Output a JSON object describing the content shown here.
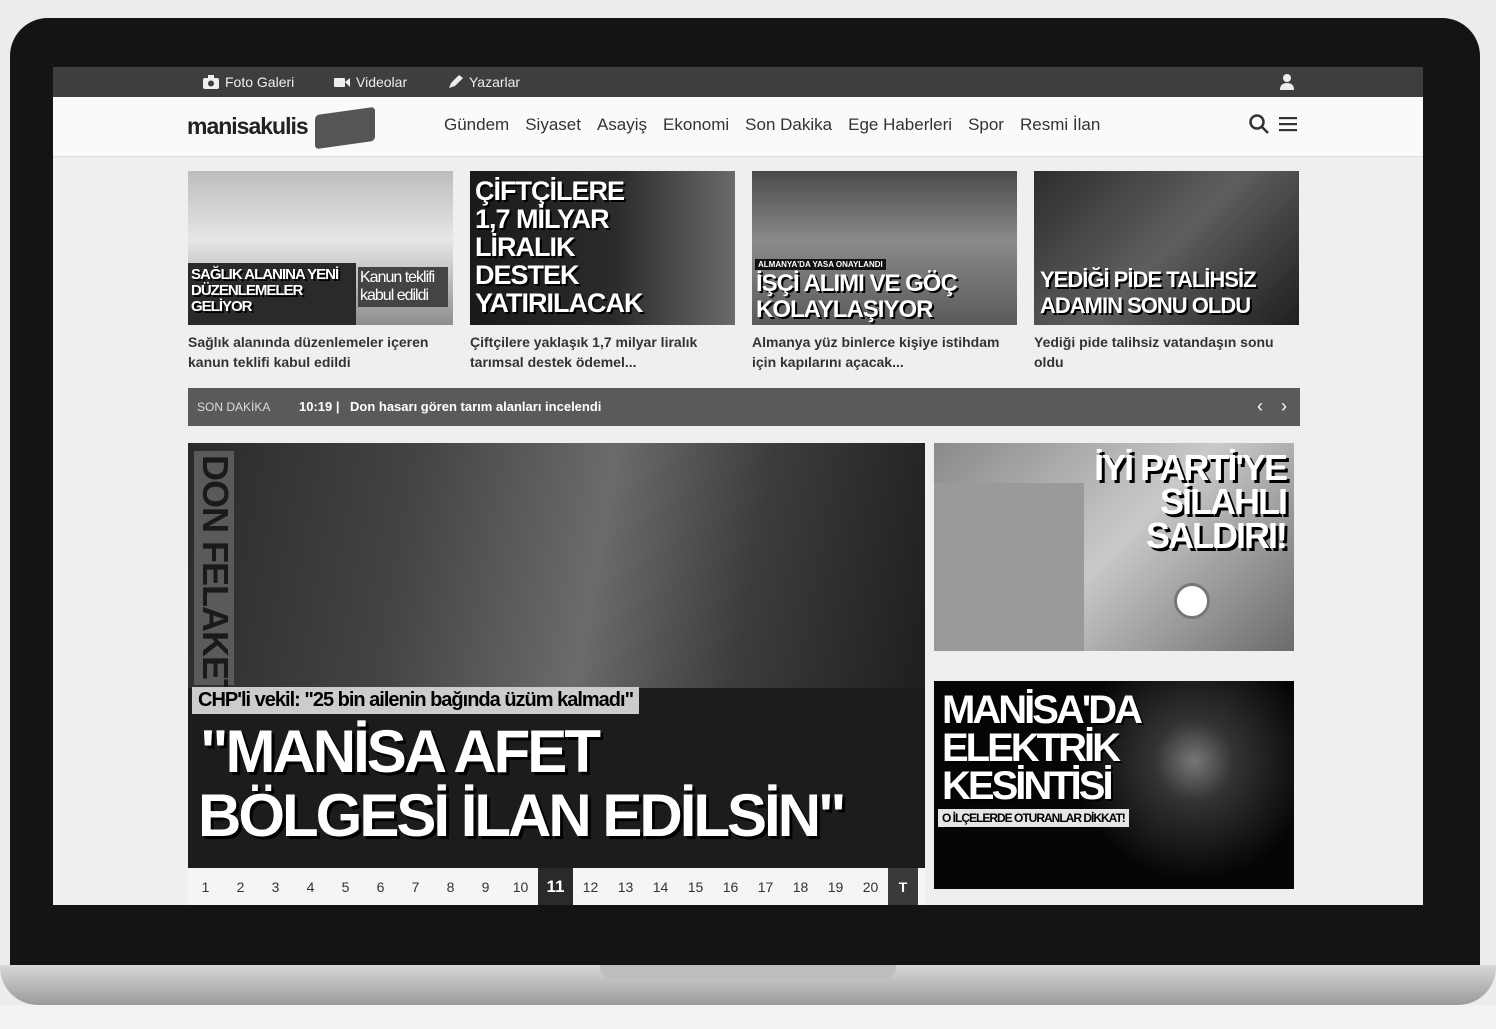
{
  "topbar": {
    "items": [
      {
        "label": "Foto Galeri",
        "icon": "camera-icon"
      },
      {
        "label": "Videolar",
        "icon": "video-icon"
      },
      {
        "label": "Yazarlar",
        "icon": "pen-icon"
      }
    ],
    "user_icon": "user-icon"
  },
  "header": {
    "logo_text": "manisakulis",
    "nav": [
      "Gündem",
      "Siyaset",
      "Asayiş",
      "Ekonomi",
      "Son Dakika",
      "Ege Haberleri",
      "Spor",
      "Resmi İlan"
    ],
    "search_icon": "search-icon",
    "menu_icon": "hamburger-icon"
  },
  "cards": [
    {
      "overlay_main": "SAĞLIK ALANINA YENİ DÜZENLEMELER GELİYOR",
      "overlay_tag": "Kanun teklifi kabul edildi",
      "caption": "Sağlık alanında düzenlemeler içeren kanun teklifi kabul edildi"
    },
    {
      "overlay_main": "ÇİFTÇİLERE 1,7 MİLYAR LİRALIK DESTEK YATIRILACAK",
      "caption": "Çiftçilere yaklaşık 1,7 milyar liralık tarımsal destek ödemel..."
    },
    {
      "overlay_tag": "ALMANYA'DA YASA ONAYLANDI",
      "overlay_main": "İŞÇİ ALIMI VE GÖÇ KOLAYLAŞIYOR",
      "caption": "Almanya yüz binlerce kişiye istihdam için kapılarını açacak..."
    },
    {
      "overlay_main": "YEDİĞİ PİDE TALİHSİZ ADAMIN SONU OLDU",
      "caption": "Yediği pide talihsiz vatandaşın sonu oldu"
    }
  ],
  "ticker": {
    "label": "SON DAKİKA",
    "time": "10:19 |",
    "text": "Don hasarı gören tarım alanları incelendi"
  },
  "slider": {
    "vertical_title": "DON FELAKETİ",
    "quote": "CHP'li vekil: \"25 bin ailenin bağında üzüm kalmadı\"",
    "headline_line1": "\"MANİSA AFET",
    "headline_line2": "BÖLGESİ İLAN EDİLSİN\"",
    "pages": [
      "1",
      "2",
      "3",
      "4",
      "5",
      "6",
      "7",
      "8",
      "9",
      "10",
      "11",
      "12",
      "13",
      "14",
      "15",
      "16",
      "17",
      "18",
      "19",
      "20"
    ],
    "active_page": "11",
    "all_label": "T"
  },
  "side_promos": [
    {
      "text": "İYİ PARTİ'YE SİLAHLI SALDIRI!"
    },
    {
      "text": "MANİSA'DA ELEKTRİK KESİNTİSİ",
      "sub": "O İLÇELERDE OTURANLAR DİKKAT!"
    }
  ]
}
